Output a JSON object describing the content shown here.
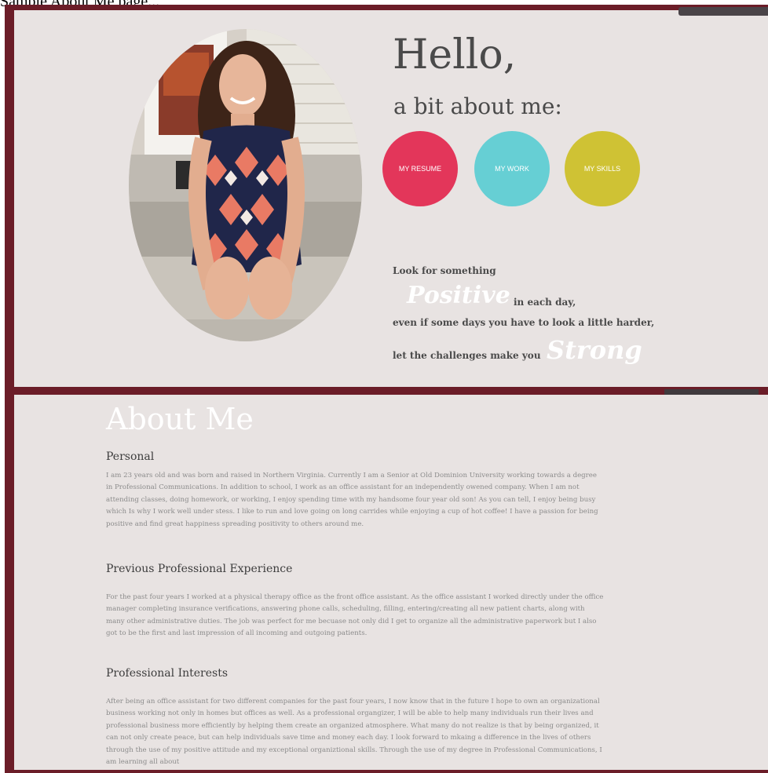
{
  "caption": "Sample About Me page...",
  "hero": {
    "greeting": "Hello,",
    "subtitle": "a bit about me:",
    "buttons": [
      {
        "label": "MY RESUME",
        "color": "#e3365a"
      },
      {
        "label": "MY WORK",
        "color": "#66cfd4"
      },
      {
        "label": "MY SKILLS",
        "color": "#cfc234"
      }
    ],
    "quote": {
      "line1": "Look for something",
      "word_positive": "Positive",
      "line2_rest": "in each day,",
      "line3": "even if some days you have to look a little harder,",
      "line4": "let the challenges make you",
      "word_strong": "Strong"
    }
  },
  "about": {
    "title": "About Me",
    "sections": [
      {
        "heading": "Personal",
        "body": "I am 23 years old and was born and raised in Northern Virginia. Currently I am a Senior at Old Dominion University working towards a degree in Professional Communications. In addition to school, I work as an office assistant for an independently owened company. When I am not attending classes, doing homework, or working, I enjoy spending time with my handsome four year old son! As you can tell, I enjoy being busy which Is why I work well under stess. I like to run and love going on long carrides while enjoying a cup of hot coffee! I have a passion for being positive and find great happiness spreading positivity to others around me."
      },
      {
        "heading": "Previous Professional Experience",
        "body": "For the past four years I worked at a physical therapy office as the front office assistant. As the office assistant I worked directly under the office manager completing insurance verifications, answering phone calls, scheduling, filling, entering/creating all new patient charts, along with many other administrative duties. The job was perfect for me becuase not only did I get to organize all the administrative paperwork but I also got to be the first and last impression of all incoming and outgoing patients."
      },
      {
        "heading": "Professional Interests",
        "body": "After being an office assistant for two different companies for the past four years, I now know that in the future I hope to own an organizational business working not only in homes but offices as well. As a professional organgizer, I will be able to help many individuals run their lives and professional business more efficiently by helping them create an organized atmosphere. What many do not realize is that by being organized, it can not only create peace, but can help individuals save time and money each day. I look forward to mkaing a difference in the lives of others through the use of my positive attitude and my exceptional organiztional skills. Through the use of my degree in Professional Communications, I am learning all about"
      }
    ]
  },
  "colors": {
    "frame": "#6b1d28",
    "panel": "#e8e3e2",
    "heading_text": "#4a4a4a",
    "body_text": "#8b8b8b"
  }
}
